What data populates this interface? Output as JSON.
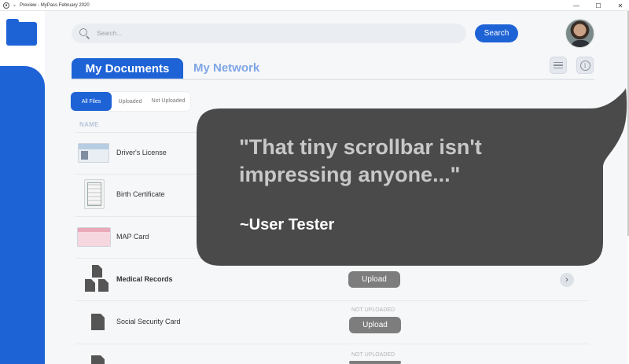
{
  "window": {
    "title": "Preview - MyPass February 2020",
    "menu_icon": "chevron-down-icon",
    "controls": [
      "minimize-icon",
      "maximize-icon",
      "close-icon"
    ]
  },
  "sidebar": {
    "logo_icon": "folder-icon",
    "accent": "#1e63d6"
  },
  "header": {
    "search_placeholder": "Search...",
    "search_button": "Search",
    "avatar": "avatar"
  },
  "tabs": [
    {
      "label": "My Documents",
      "active": true
    },
    {
      "label": "My Network",
      "active": false
    }
  ],
  "toolbar": {
    "menu_icon": "hamburger-icon",
    "info_icon": "info-icon"
  },
  "filters": [
    {
      "label": "All Files",
      "active": true
    },
    {
      "label": "Uploaded",
      "active": false
    },
    {
      "label": "Not Uploaded",
      "active": false
    }
  ],
  "table": {
    "column_name": "NAME",
    "rows": [
      {
        "name": "Driver's License",
        "thumb": "license"
      },
      {
        "name": "Birth Certificate",
        "thumb": "certificate"
      },
      {
        "name": "MAP Card",
        "thumb": "card"
      },
      {
        "name": "Medical Records",
        "status": "",
        "action": "Upload",
        "bold": true
      },
      {
        "name": "Social Security Card",
        "status": "NOT UPLOADED",
        "action": "Upload"
      },
      {
        "name": "",
        "status": "NOT UPLOADED",
        "action": ""
      }
    ]
  },
  "callout": {
    "quote": "\"That tiny  scrollbar isn't impressing anyone...\"",
    "attribution": "~User Tester",
    "bubble_color": "#4a4a4a"
  },
  "colors": {
    "primary": "#1e63d6",
    "button_gray": "#7d7d7d"
  }
}
